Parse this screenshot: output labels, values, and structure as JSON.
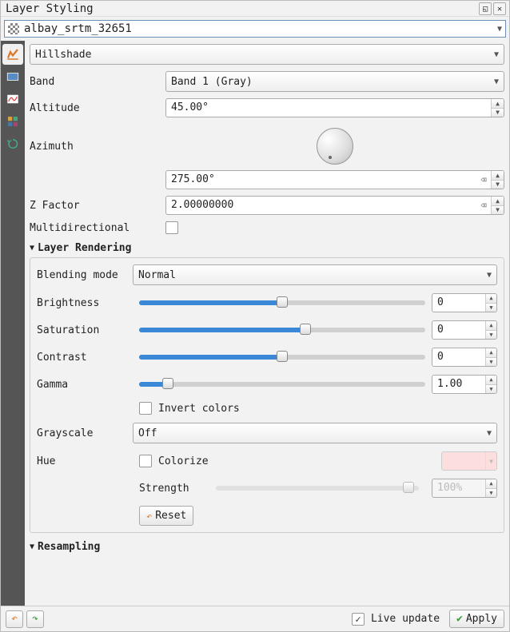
{
  "panel": {
    "title": "Layer Styling"
  },
  "layer": {
    "name": "albay_srtm_32651"
  },
  "symbology": {
    "render_type": "Hillshade",
    "band_label": "Band",
    "band_value": "Band 1 (Gray)",
    "altitude_label": "Altitude",
    "altitude_value": "45.00°",
    "azimuth_label": "Azimuth",
    "azimuth_value": "275.00°",
    "zfactor_label": "Z Factor",
    "zfactor_value": "2.00000000",
    "multidir_label": "Multidirectional",
    "multidir_checked": false
  },
  "layer_rendering": {
    "title": "Layer Rendering",
    "blending_label": "Blending mode",
    "blending_value": "Normal",
    "brightness_label": "Brightness",
    "brightness_value": "0",
    "saturation_label": "Saturation",
    "saturation_value": "0",
    "contrast_label": "Contrast",
    "contrast_value": "0",
    "gamma_label": "Gamma",
    "gamma_value": "1.00",
    "invert_label": "Invert colors",
    "invert_checked": false,
    "grayscale_label": "Grayscale",
    "grayscale_value": "Off",
    "hue_label": "Hue",
    "colorize_label": "Colorize",
    "colorize_checked": false,
    "strength_label": "Strength",
    "strength_value": "100%",
    "reset_label": "Reset"
  },
  "resampling": {
    "title": "Resampling"
  },
  "footer": {
    "live_update_label": "Live update",
    "live_update_checked": true,
    "apply_label": "Apply"
  }
}
